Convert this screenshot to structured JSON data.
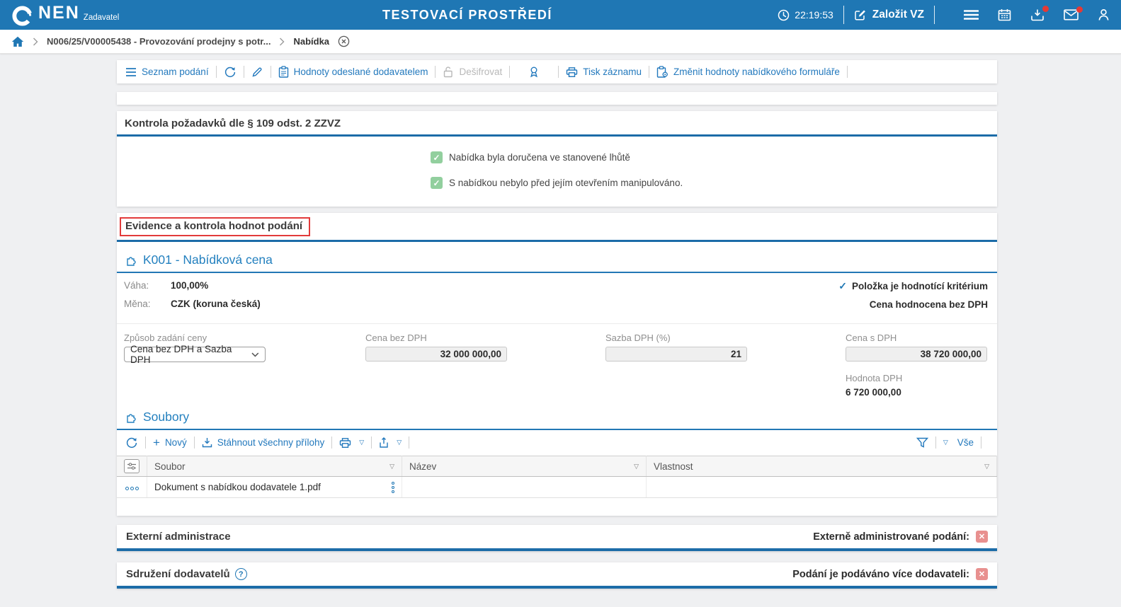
{
  "colors": {
    "topbar_blue": "#1f77b4",
    "section_underline_blue": "#1c6ca8",
    "link_blue": "#2379bd",
    "green_check": "#92cf9e",
    "red_badge": "#e8908f",
    "annotation_red": "#e23b3b",
    "notification_red": "#e53935"
  },
  "topbar": {
    "logo": "NEN",
    "logo_sub": "Zadavatel",
    "env_title": "TESTOVACÍ PROSTŘEDÍ",
    "time": "22:19:53",
    "create_vz": "Založit VZ"
  },
  "breadcrumb": {
    "item1": "N006/25/V00005438 - Provozování prodejny s potr...",
    "item2": "Nabídka"
  },
  "record_toolbar": {
    "seznam_podani": "Seznam podání",
    "hodnoty_odeslane": "Hodnoty odeslané dodavatelem",
    "desifrovat": "Dešifrovat",
    "tisk_zaznamu": "Tisk záznamu",
    "zmenit_hodnoty": "Změnit hodnoty nabídkového formuláře"
  },
  "kontrola": {
    "title": "Kontrola požadavků dle § 109 odst. 2 ZZVZ",
    "check1": "Nabídka byla doručena ve stanovené lhůtě",
    "check2": "S nabídkou nebylo před jejím otevřením manipulováno."
  },
  "evidence": {
    "title": "Evidence a kontrola hodnot podání",
    "k001": {
      "title": "K001 - Nabídková cena",
      "vaha_label": "Váha:",
      "vaha_value": "100,00%",
      "mena_label": "Měna:",
      "mena_value": "CZK (koruna česká)",
      "flag1": "Položka je hodnotící kritérium",
      "flag2": "Cena hodnocena bez DPH",
      "zpusob_label": "Způsob zadání ceny",
      "zpusob_value": "Cena bez DPH a Sazba DPH",
      "cena_bez_label": "Cena bez DPH",
      "cena_bez_value": "32 000 000,00",
      "sazba_label": "Sazba DPH (%)",
      "sazba_value": "21",
      "cena_s_label": "Cena s DPH",
      "cena_s_value": "38 720 000,00",
      "hodnota_dph_label": "Hodnota DPH",
      "hodnota_dph_value": "6 720 000,00"
    },
    "soubory": {
      "title": "Soubory",
      "novy": "Nový",
      "stahnout": "Stáhnout všechny přílohy",
      "vse": "Vše",
      "table": {
        "columns": [
          "Soubor",
          "Název",
          "Vlastnost"
        ],
        "rows": [
          {
            "soubor": "Dokument s nabídkou dodavatele 1.pdf",
            "nazev": "",
            "vlastnost": ""
          }
        ]
      }
    }
  },
  "externi": {
    "title": "Externí administrace",
    "right_label": "Externě administrované podání:"
  },
  "sdruzeni": {
    "title": "Sdružení dodavatelů",
    "right_label": "Podání je podáváno více dodavateli:"
  }
}
